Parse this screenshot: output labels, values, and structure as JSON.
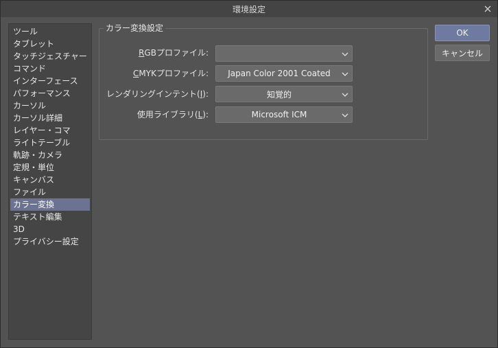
{
  "window": {
    "title": "環境設定"
  },
  "sidebar": {
    "items": [
      {
        "label": "ツール"
      },
      {
        "label": "タブレット"
      },
      {
        "label": "タッチジェスチャー"
      },
      {
        "label": "コマンド"
      },
      {
        "label": "インターフェース"
      },
      {
        "label": "パフォーマンス"
      },
      {
        "label": "カーソル"
      },
      {
        "label": "カーソル詳細"
      },
      {
        "label": "レイヤー・コマ"
      },
      {
        "label": "ライトテーブル"
      },
      {
        "label": "軌跡・カメラ"
      },
      {
        "label": "定規・単位"
      },
      {
        "label": "キャンバス"
      },
      {
        "label": "ファイル"
      },
      {
        "label": "カラー変換",
        "selected": true
      },
      {
        "label": "テキスト編集"
      },
      {
        "label": "3D"
      },
      {
        "label": "プライバシー設定"
      }
    ]
  },
  "group": {
    "title": "カラー変換設定"
  },
  "fields": {
    "rgb_profile": {
      "mnemonic": "R",
      "label_rest": "GBプロファイル:",
      "value": ""
    },
    "cmyk_profile": {
      "mnemonic": "C",
      "label_rest": "MYKプロファイル:",
      "value": "Japan Color 2001 Coated"
    },
    "rendering_intent": {
      "label_pre": "レンダリングインテント(",
      "mnemonic": "I",
      "label_post": "):",
      "value": "知覚的"
    },
    "library": {
      "label_pre": "使用ライブラリ(",
      "mnemonic": "L",
      "label_post": "):",
      "value": "Microsoft ICM"
    }
  },
  "buttons": {
    "ok": "OK",
    "cancel": "キャンセル"
  },
  "colors": {
    "accent": "#6f7aa0",
    "selected_item": "#6b7390",
    "window_bg": "#535353"
  },
  "icons": {
    "close": "close-icon",
    "dropdown": "chevron-down-icon"
  }
}
